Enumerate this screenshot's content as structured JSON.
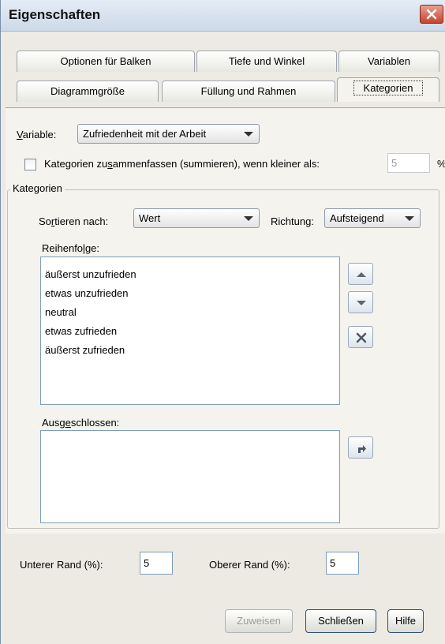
{
  "window": {
    "title": "Eigenschaften"
  },
  "tabs_row1": [
    "Optionen für Balken",
    "Tiefe und Winkel",
    "Variablen"
  ],
  "tabs_row2": [
    "Diagrammgröße",
    "Füllung und Rahmen",
    "Kategorien"
  ],
  "active_tab": "Kategorien",
  "variable": {
    "label": "Variable:",
    "value": "Zufriedenheit mit der Arbeit"
  },
  "collapse": {
    "label": "Kategorien zusammenfassen (summieren), wenn kleiner als:",
    "checked": false,
    "value": "5",
    "unit": "%"
  },
  "categories_group": {
    "title": "Kategorien",
    "sort_label": "Sortieren nach:",
    "sort_value": "Wert",
    "direction_label": "Richtung:",
    "direction_value": "Aufsteigend",
    "order_label": "Reihenfolge:",
    "order_items": [
      "äußerst unzufrieden",
      "etwas unzufrieden",
      "neutral",
      "etwas zufrieden",
      "äußerst zufrieden"
    ],
    "excluded_label": "Ausgeschlossen:",
    "excluded_items": []
  },
  "margins": {
    "lower_label": "Unterer Rand (%):",
    "lower_value": "5",
    "upper_label": "Oberer Rand (%):",
    "upper_value": "5"
  },
  "buttons": {
    "apply": "Zuweisen",
    "close": "Schließen",
    "help": "Hilfe"
  },
  "icons": {
    "move_up": "arrow-up-icon",
    "move_down": "arrow-down-icon",
    "exclude": "x-icon",
    "restore": "restore-arrow-icon",
    "window_close": "close-icon"
  }
}
